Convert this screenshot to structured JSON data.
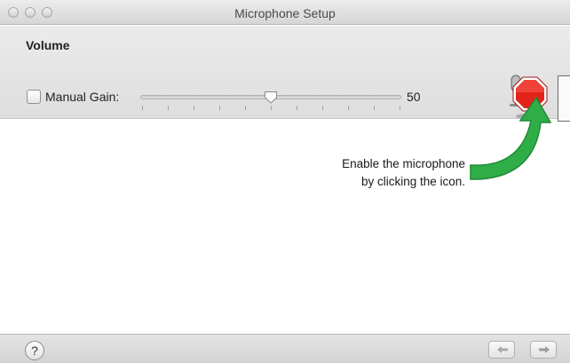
{
  "window": {
    "title": "Microphone Setup"
  },
  "volume": {
    "section_label": "Volume",
    "manual_gain_label": "Manual Gain:",
    "manual_gain_checked": false,
    "gain_value": "50",
    "slider_level": 0.5
  },
  "callout": {
    "line1": "Enable the microphone",
    "line2": "by clicking the icon."
  },
  "icons": {
    "mic_button": "stop-sign-microphone-icon",
    "help": "help-icon",
    "back": "arrow-left-icon",
    "forward": "arrow-right-icon"
  },
  "footer": {
    "help_label": "?"
  },
  "colors": {
    "stop_red": "#e2231a",
    "arrow_green": "#2fae48",
    "panel_bg": "#e5e5e5"
  }
}
